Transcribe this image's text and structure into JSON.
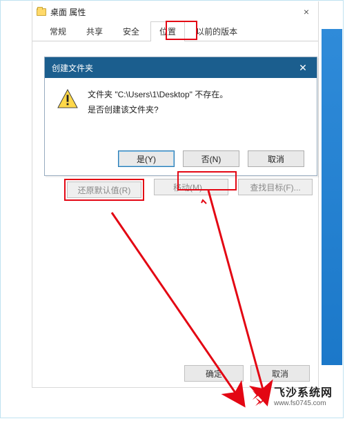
{
  "window": {
    "title": "桌面 属性",
    "tabs": [
      "常规",
      "共享",
      "安全",
      "位置",
      "以前的版本"
    ],
    "selected_tab_index": 3,
    "buttons": {
      "restore": "还原默认值(R)",
      "move": "移动(M)...",
      "find_target": "查找目标(F)..."
    },
    "footer": {
      "ok": "确定",
      "cancel": "取消"
    }
  },
  "dialog": {
    "title": "创建文件夹",
    "line1": "文件夹 \"C:\\Users\\1\\Desktop\" 不存在。",
    "line2": "是否创建该文件夹?",
    "yes": "是(Y)",
    "no": "否(N)",
    "cancel": "取消"
  },
  "watermark": {
    "cn": "飞沙系统网",
    "en": "www.fs0745.com"
  }
}
